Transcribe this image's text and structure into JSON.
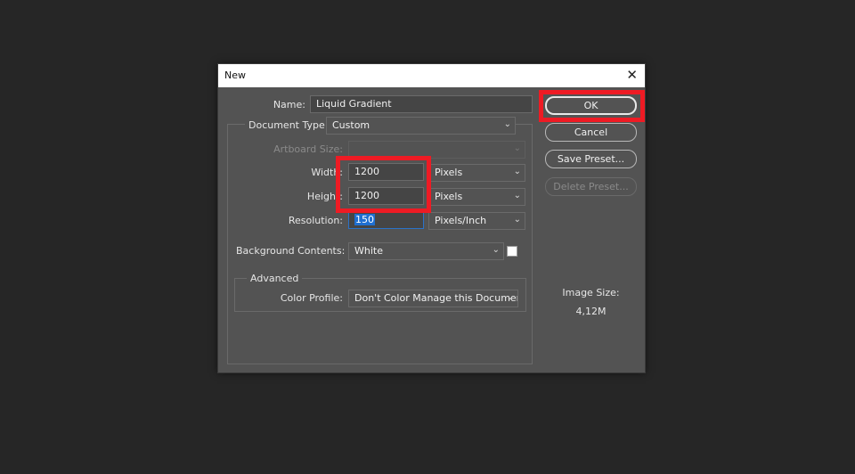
{
  "dialog": {
    "title": "New",
    "close_glyph": "✕"
  },
  "form": {
    "name_label": "Name:",
    "name_value": "Liquid Gradient",
    "doc_type_label": "Document Type:",
    "doc_type_value": "Custom",
    "artboard_label": "Artboard Size:",
    "artboard_value": "",
    "width_label": "Width:",
    "width_value": "1200",
    "width_unit": "Pixels",
    "height_label": "Height:",
    "height_value": "1200",
    "height_unit": "Pixels",
    "resolution_label": "Resolution:",
    "resolution_value": "150",
    "resolution_unit": "Pixels/Inch",
    "background_label": "Background Contents:",
    "background_value": "White",
    "background_swatch": "#ffffff",
    "advanced_legend": "Advanced",
    "color_profile_label": "Color Profile:",
    "color_profile_value": "Don't Color Manage this Document"
  },
  "buttons": {
    "ok": "OK",
    "cancel": "Cancel",
    "save_preset": "Save Preset...",
    "delete_preset": "Delete Preset..."
  },
  "image_size": {
    "label": "Image Size:",
    "value": "4,12M"
  },
  "annotations": {
    "highlight_color": "#ee1b24"
  }
}
